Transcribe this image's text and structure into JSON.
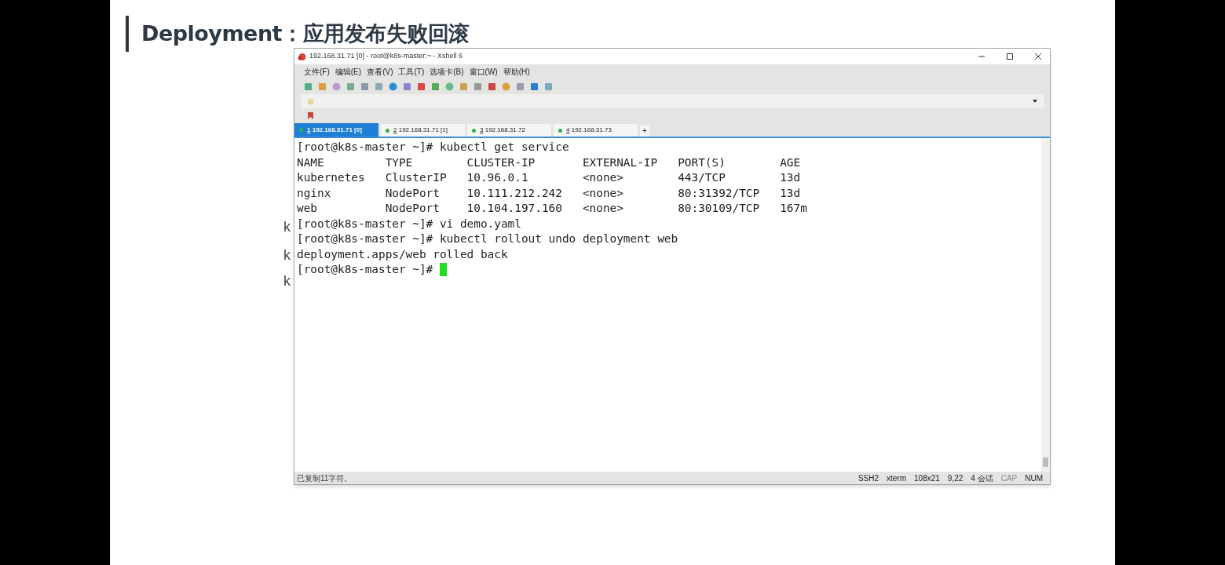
{
  "slide": {
    "title": "Deployment：应用发布失败回滚",
    "fragments": [
      "k",
      "k",
      "k"
    ]
  },
  "window": {
    "title": "192.168.31.71 [0] - root@k8s-master:~ - Xshell 6",
    "menu": [
      "文件(F)",
      "编辑(E)",
      "查看(V)",
      "工具(T)",
      "选项卡(B)",
      "窗口(W)",
      "帮助(H)"
    ],
    "tabs": [
      {
        "number": "1",
        "label": "192.168.31.71 [0]",
        "selected": true
      },
      {
        "number": "2",
        "label": "192.168.31.71 [1]",
        "selected": false
      },
      {
        "number": "3",
        "label": "192.168.31.72",
        "selected": false
      },
      {
        "number": "4",
        "label": "192.168.31.73",
        "selected": false
      }
    ],
    "new_tab": "+",
    "terminal": {
      "lines": [
        "[root@k8s-master ~]# kubectl get service",
        "NAME         TYPE        CLUSTER-IP       EXTERNAL-IP   PORT(S)        AGE",
        "kubernetes   ClusterIP   10.96.0.1        <none>        443/TCP        13d",
        "nginx        NodePort    10.111.212.242   <none>        80:31392/TCP   13d",
        "web          NodePort    10.104.197.160   <none>        80:30109/TCP   167m",
        "[root@k8s-master ~]# vi demo.yaml",
        "[root@k8s-master ~]# kubectl rollout undo deployment web",
        "deployment.apps/web rolled back",
        "[root@k8s-master ~]# "
      ],
      "cursor": true
    },
    "status_bar": {
      "message": "已复制11字符。",
      "items": [
        {
          "text": "SSH2",
          "disabled": false
        },
        {
          "text": "xterm",
          "disabled": false
        },
        {
          "text": "108x21",
          "disabled": false
        },
        {
          "text": "9,22",
          "disabled": false
        },
        {
          "text": "4 会话",
          "disabled": false
        },
        {
          "text": "CAP",
          "disabled": true
        },
        {
          "text": "NUM",
          "disabled": false
        }
      ]
    }
  }
}
